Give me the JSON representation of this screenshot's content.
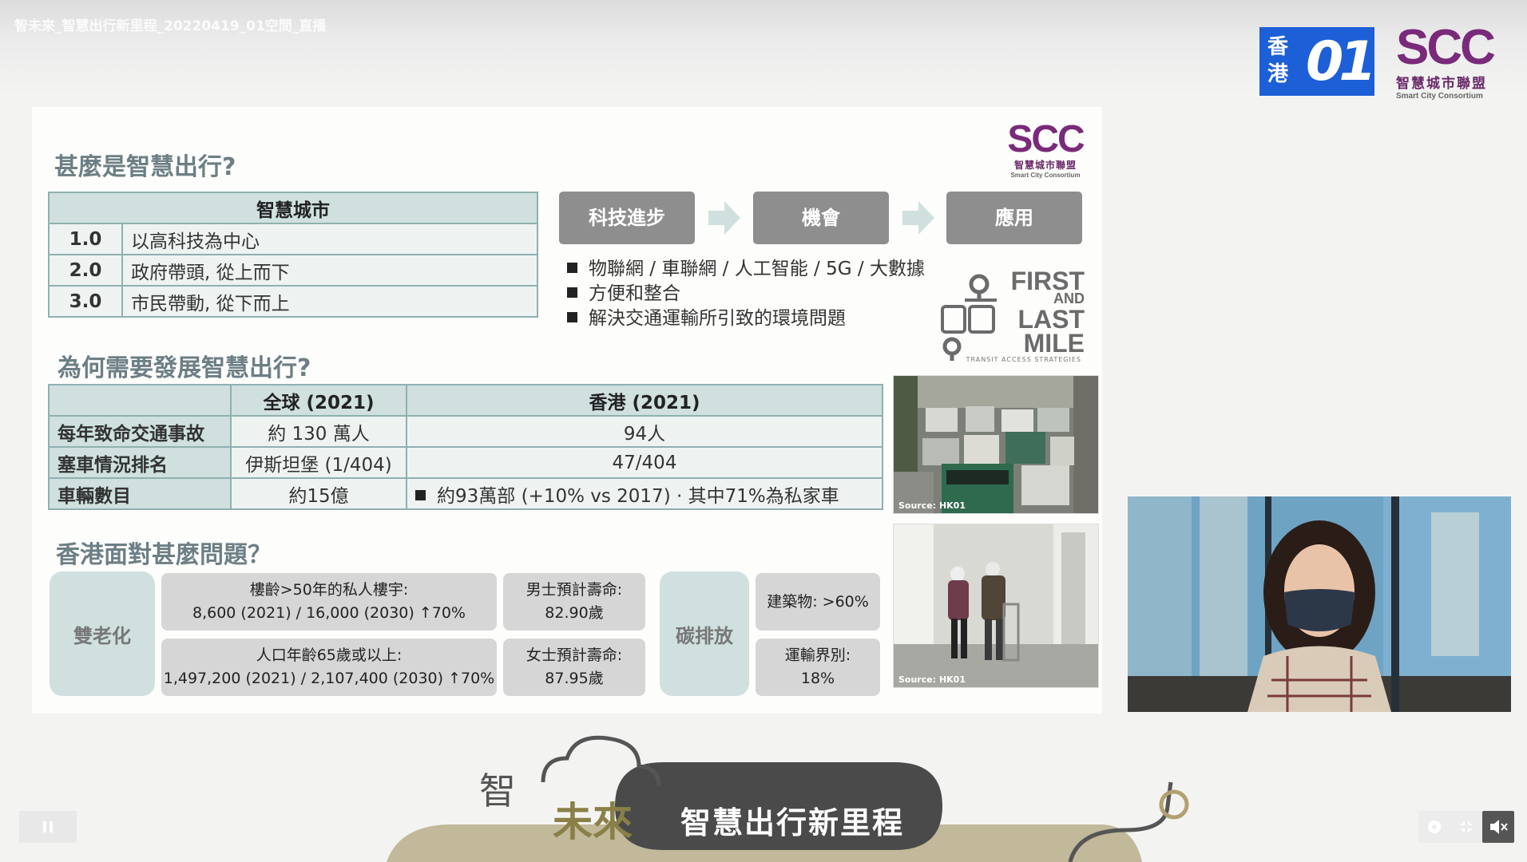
{
  "video": {
    "title": "智未來_智慧出行新里程_20220419_01空間_直播"
  },
  "logos": {
    "hk01": {
      "chars": "香港",
      "mark": "01"
    },
    "scc": {
      "mark": "SCC",
      "zh": "智慧城市聯盟",
      "en": "Smart City Consortium"
    }
  },
  "slide": {
    "heading1": "甚麼是智慧出行?",
    "smart_city_table": {
      "header": "智慧城市",
      "rows": [
        {
          "num": "1.0",
          "text": "以高科技為中心"
        },
        {
          "num": "2.0",
          "text": "政府帶頭, 從上而下"
        },
        {
          "num": "3.0",
          "text": "市民帶動, 從下而上"
        }
      ]
    },
    "flow": [
      "科技進步",
      "機會",
      "應用"
    ],
    "bullets": [
      "物聯網 / 車聯網 / 人工智能 / 5G / 大數據",
      "方便和整合",
      "解決交通運輸所引致的環境問題"
    ],
    "first_last_mile": {
      "first": "FIRST",
      "and": "AND",
      "last": "LAST",
      "mile": "MILE",
      "sub": "TRANSIT ACCESS STRATEGIES"
    },
    "heading2": "為何需要發展智慧出行?",
    "why_table": {
      "headers": [
        "",
        "全球 (2021)",
        "香港 (2021)"
      ],
      "rows": [
        {
          "label": "每年致命交通事故",
          "global": "約 130 萬人",
          "hk": "94人"
        },
        {
          "label": "塞車情況排名",
          "global": "伊斯坦堡 (1/404)",
          "hk": "47/404"
        },
        {
          "label": "車輛數目",
          "global": "約15億",
          "hk": "約93萬部 (+10% vs 2017) · 其中71%為私家車"
        }
      ]
    },
    "photo_source_1": "Source: HK01",
    "photo_source_2": "Source: HK01",
    "heading3": "香港面對甚麼問題？",
    "issues": {
      "aging_label": "雙老化",
      "building_title": "樓齡>50年的私人樓宇:",
      "building_value": "8,600 (2021) / 16,000 (2030)  ↑70%",
      "population_title": "人口年齡65歲或以上:",
      "population_value": "1,497,200 (2021) / 2,107,400 (2030) ↑70%",
      "male_title": "男士預計壽命:",
      "male_value": "82.90歲",
      "female_title": "女士預計壽命:",
      "female_value": "87.95歲",
      "carbon_label": "碳排放",
      "building_emission": "建築物: >60%",
      "transport_title": "運輸界別:",
      "transport_value": "18%"
    }
  },
  "footer": {
    "logo_a": "智",
    "logo_b": "未來",
    "title": "智慧出行新里程"
  },
  "controls": {
    "pause_icon": "pause-icon",
    "settings_icon": "gear-icon",
    "exit_fullscreen_icon": "exit-fullscreen-icon",
    "mute_icon": "muted-speaker-icon"
  },
  "colors": {
    "table_header": "#cfe0df",
    "flow_box": "#8e8e8e",
    "heading": "#6c7f85",
    "scc_purple": "#7a2a7a",
    "hk01_blue": "#1d5fd6"
  }
}
